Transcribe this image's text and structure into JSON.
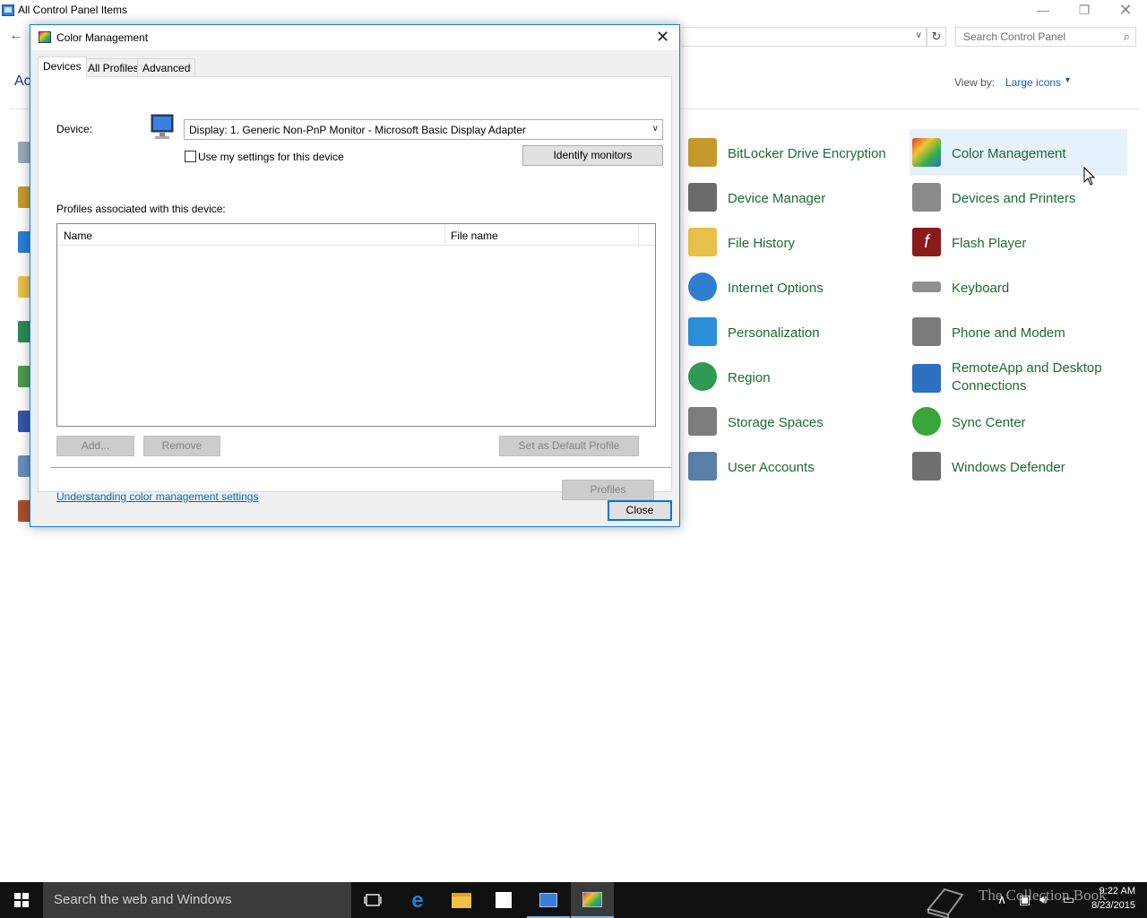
{
  "control_panel": {
    "window_title": "All Control Panel Items",
    "search_placeholder": "Search Control Panel",
    "heading_fragment": "Ac",
    "view_by_label": "View by:",
    "view_by_value": "Large icons",
    "items": [
      {
        "label": "BitLocker Drive Encryption",
        "icon": "bitlocker-keys-icon",
        "color": "#c49a2e"
      },
      {
        "label": "Color Management",
        "icon": "color-management-icon",
        "color": "#3c78d8",
        "selected": true
      },
      {
        "label": "Device Manager",
        "icon": "device-manager-icon",
        "color": "#6b6b6b"
      },
      {
        "label": "Devices and Printers",
        "icon": "printer-icon",
        "color": "#8a8a8a"
      },
      {
        "label": "File History",
        "icon": "file-history-icon",
        "color": "#e8c04a"
      },
      {
        "label": "Flash Player",
        "icon": "flash-player-icon",
        "color": "#8b1a1a"
      },
      {
        "label": "Internet Options",
        "icon": "internet-options-icon",
        "color": "#2f7fd0"
      },
      {
        "label": "Keyboard",
        "icon": "keyboard-icon",
        "color": "#8f8f8f"
      },
      {
        "label": "Personalization",
        "icon": "personalization-icon",
        "color": "#2a8fd8"
      },
      {
        "label": "Phone and Modem",
        "icon": "phone-modem-icon",
        "color": "#7a7a7a"
      },
      {
        "label": "Region",
        "icon": "region-globe-icon",
        "color": "#2e9a55"
      },
      {
        "label": "RemoteApp and Desktop Connections",
        "icon": "remoteapp-icon",
        "color": "#2f6fc0"
      },
      {
        "label": "Storage Spaces",
        "icon": "storage-spaces-icon",
        "color": "#7d7d7d"
      },
      {
        "label": "Sync Center",
        "icon": "sync-center-icon",
        "color": "#3aa53a"
      },
      {
        "label": "User Accounts",
        "icon": "user-accounts-icon",
        "color": "#5a7fa8"
      },
      {
        "label": "Windows Defender",
        "icon": "windows-defender-icon",
        "color": "#6f6f6f"
      }
    ]
  },
  "dialog": {
    "title": "Color Management",
    "tabs": [
      "Devices",
      "All Profiles",
      "Advanced"
    ],
    "active_tab": "Devices",
    "device_label": "Device:",
    "device_value": "Display: 1. Generic Non-PnP Monitor - Microsoft Basic Display Adapter",
    "use_settings_label": "Use my settings for this device",
    "use_settings_checked": false,
    "identify_button": "Identify monitors",
    "profiles_heading": "Profiles associated with this device:",
    "columns": [
      "Name",
      "File name"
    ],
    "rows": [],
    "add_button": "Add...",
    "remove_button": "Remove",
    "set_default_button": "Set as Default Profile",
    "help_link": "Understanding color management settings",
    "profiles_button": "Profiles",
    "close_button": "Close"
  },
  "taskbar": {
    "search_placeholder": "Search the web and Windows",
    "time": "9:22 AM",
    "date": "8/23/2015",
    "watermark": "The Collection Book",
    "accent": "#76b9ed"
  }
}
